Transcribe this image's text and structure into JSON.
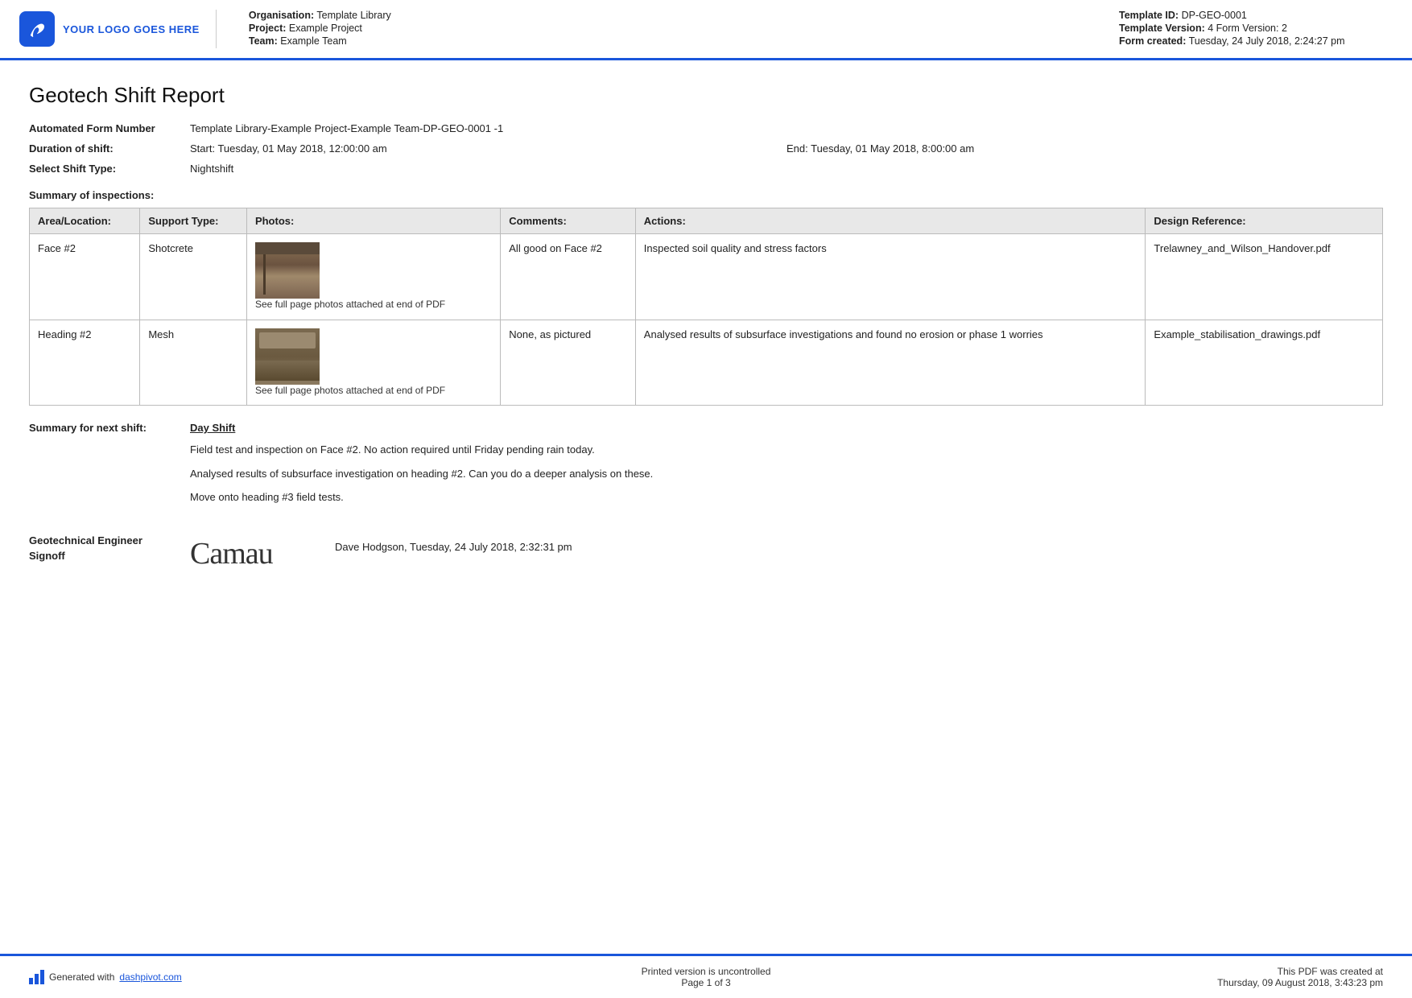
{
  "header": {
    "logo_text": "YOUR LOGO GOES HERE",
    "organisation_label": "Organisation:",
    "organisation_value": "Template Library",
    "project_label": "Project:",
    "project_value": "Example Project",
    "team_label": "Team:",
    "team_value": "Example Team",
    "template_id_label": "Template ID:",
    "template_id_value": "DP-GEO-0001",
    "template_version_label": "Template Version:",
    "template_version_value": "4",
    "form_version_label": "Form Version:",
    "form_version_value": "2",
    "form_created_label": "Form created:",
    "form_created_value": "Tuesday, 24 July 2018, 2:24:27 pm"
  },
  "report": {
    "title": "Geotech Shift Report",
    "automated_form_label": "Automated Form Number",
    "automated_form_value": "Template Library-Example Project-Example Team-DP-GEO-0001   -1",
    "duration_label": "Duration of shift:",
    "duration_start": "Start: Tuesday, 01 May 2018, 12:00:00 am",
    "duration_end": "End: Tuesday, 01 May 2018, 8:00:00 am",
    "shift_type_label": "Select Shift Type:",
    "shift_type_value": "Nightshift",
    "summary_inspections_label": "Summary of inspections:"
  },
  "table": {
    "headers": [
      "Area/Location:",
      "Support Type:",
      "Photos:",
      "Comments:",
      "Actions:",
      "Design Reference:"
    ],
    "rows": [
      {
        "area": "Face #2",
        "support": "Shotcrete",
        "photo_caption": "See full page photos attached at end of PDF",
        "comments": "All good on Face #2",
        "actions": "Inspected soil quality and stress factors",
        "design_ref": "Trelawney_and_Wilson_Handover.pdf"
      },
      {
        "area": "Heading #2",
        "support": "Mesh",
        "photo_caption": "See full page photos attached at end of PDF",
        "comments": "None, as pictured",
        "actions": "Analysed results of subsurface investigations and found no erosion or phase 1 worries",
        "design_ref": "Example_stabilisation_drawings.pdf"
      }
    ]
  },
  "summary": {
    "label": "Summary for next shift:",
    "next_shift_title": "Day Shift",
    "paragraphs": [
      "Field test and inspection on Face #2. No action required until Friday pending rain today.",
      "Analysed results of subsurface investigation on heading #2. Can you do a deeper analysis on these.",
      "Move onto heading #3 field tests."
    ]
  },
  "signoff": {
    "label_line1": "Geotechnical Engineer",
    "label_line2": "Signoff",
    "signoff_info": "Dave Hodgson, Tuesday, 24 July 2018, 2:32:31 pm"
  },
  "footer": {
    "generated_text": "Generated with",
    "generated_link": "dashpivot.com",
    "center_text": "Printed version is uncontrolled",
    "page_text": "Page 1 of 3",
    "right_text": "This PDF was created at",
    "right_date": "Thursday, 09 August 2018, 3:43:23 pm"
  }
}
